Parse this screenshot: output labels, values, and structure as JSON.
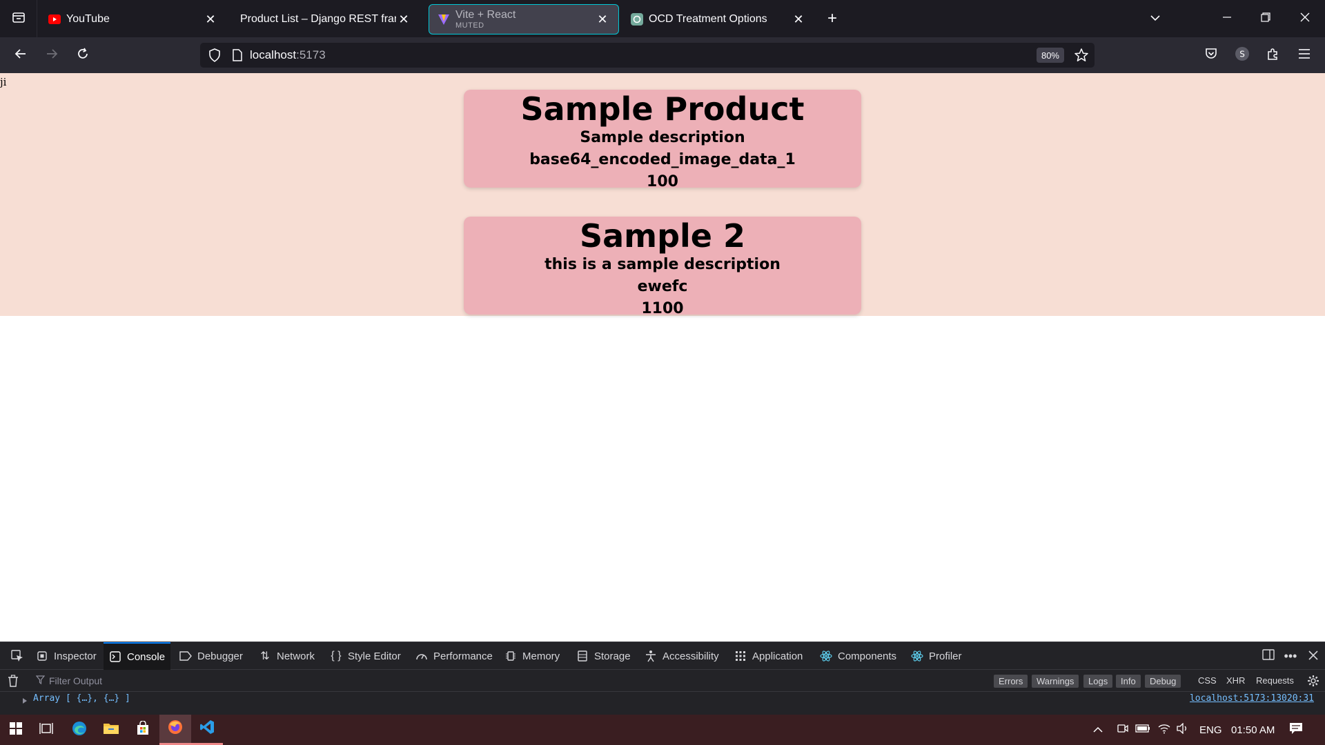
{
  "tabs": [
    {
      "title": "YouTube",
      "favicon": "youtube-icon"
    },
    {
      "title": "Product List – Django REST framew",
      "favicon": ""
    },
    {
      "title": "Vite + React",
      "subtitle": "MUTED",
      "favicon": "vite-icon",
      "active": true
    },
    {
      "title": "OCD Treatment Options",
      "favicon": "chatgpt-icon"
    }
  ],
  "navbar": {
    "url_host": "localhost",
    "url_port": ":5173",
    "zoom": "80%"
  },
  "page": {
    "stray_text": "ji",
    "products": [
      {
        "name": "Sample Product",
        "description": "Sample description",
        "image": "base64_encoded_image_data_1",
        "price": "100"
      },
      {
        "name": "Sample 2",
        "description": "this is a sample description",
        "image": "ewefc",
        "price": "1100"
      }
    ]
  },
  "devtools": {
    "tabs": [
      "Inspector",
      "Console",
      "Debugger",
      "Network",
      "Style Editor",
      "Performance",
      "Memory",
      "Storage",
      "Accessibility",
      "Application",
      "Components",
      "Profiler"
    ],
    "active_tab": "Console",
    "filter_placeholder": "Filter Output",
    "levels": [
      "Errors",
      "Warnings",
      "Logs",
      "Info",
      "Debug"
    ],
    "categories": [
      "CSS",
      "XHR",
      "Requests"
    ],
    "log_message": "Array [ {…}, {…} ]",
    "log_source": "localhost:5173:13020:31"
  },
  "taskbar": {
    "language": "ENG",
    "time": "01:50 AM"
  },
  "colors": {
    "page_bg": "#f7ded4",
    "card_bg": "#edb0b7",
    "active_tab_border": "#00c8d7",
    "devtools_accent": "#0a84ff"
  }
}
